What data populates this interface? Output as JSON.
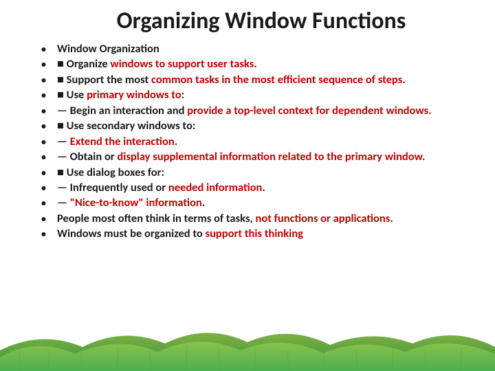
{
  "title": "Organizing Window Functions",
  "bullets": [
    {
      "segments": [
        {
          "t": "Window Organization",
          "c": "plain"
        }
      ]
    },
    {
      "segments": [
        {
          "t": "■ Organize ",
          "c": "plain"
        },
        {
          "t": "windows to support user tasks",
          "c": "red"
        },
        {
          "t": ".",
          "c": "plain"
        }
      ]
    },
    {
      "segments": [
        {
          "t": "■ Support the most ",
          "c": "plain"
        },
        {
          "t": "common tasks in the most efficient sequence of steps",
          "c": "red"
        },
        {
          "t": ".",
          "c": "plain"
        }
      ]
    },
    {
      "segments": [
        {
          "t": "■ Use ",
          "c": "plain"
        },
        {
          "t": "primary windows to",
          "c": "red"
        },
        {
          "t": ":",
          "c": "plain"
        }
      ]
    },
    {
      "segments": [
        {
          "t": "— Begin an interaction and ",
          "c": "plain"
        },
        {
          "t": "provide a top-level context for dependent windows.",
          "c": "red"
        }
      ]
    },
    {
      "segments": [
        {
          "t": "■ Use secondary windows to:",
          "c": "plain"
        }
      ]
    },
    {
      "segments": [
        {
          "t": "— ",
          "c": "plain"
        },
        {
          "t": "Extend the interaction",
          "c": "red"
        },
        {
          "t": ".",
          "c": "plain"
        }
      ]
    },
    {
      "segments": [
        {
          "t": "— Obtain or ",
          "c": "plain"
        },
        {
          "t": "display supplemental information related to the primary window",
          "c": "red"
        },
        {
          "t": ".",
          "c": "plain"
        }
      ]
    },
    {
      "segments": [
        {
          "t": "■ Use dialog boxes for:",
          "c": "plain"
        }
      ]
    },
    {
      "segments": [
        {
          "t": "— Infrequently used or ",
          "c": "plain"
        },
        {
          "t": "needed information",
          "c": "red"
        },
        {
          "t": ".",
          "c": "plain"
        }
      ]
    },
    {
      "segments": [
        {
          "t": "— ",
          "c": "plain"
        },
        {
          "t": "\"Nice-to-know\" information",
          "c": "red"
        },
        {
          "t": ".",
          "c": "plain"
        }
      ]
    },
    {
      "segments": [
        {
          "t": "People most often think in terms of tasks, ",
          "c": "plain"
        },
        {
          "t": "not functions or applications",
          "c": "red"
        },
        {
          "t": ".",
          "c": "plain"
        }
      ]
    },
    {
      "segments": [
        {
          "t": "Windows must be organized to ",
          "c": "plain"
        },
        {
          "t": "support this thinking",
          "c": "red"
        }
      ]
    }
  ]
}
